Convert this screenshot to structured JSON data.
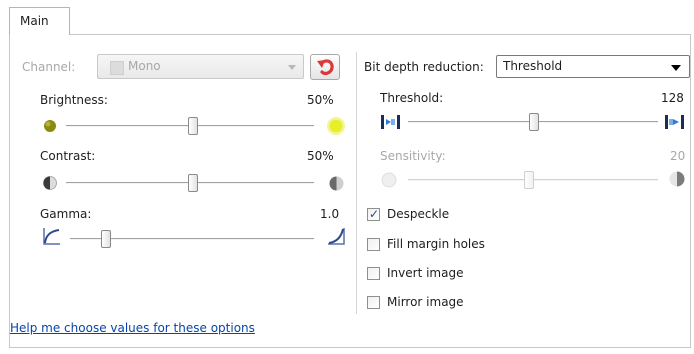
{
  "tabs": [
    {
      "label": "Main",
      "selected": true
    }
  ],
  "channel": {
    "label": "Channel:",
    "value": "Mono",
    "enabled": false
  },
  "reset_icon": "undo-arrow-icon",
  "sliders_left": [
    {
      "label": "Brightness:",
      "value": "50%",
      "position": 0.5,
      "left_icon": "brightness-low-icon",
      "right_icon": "brightness-high-icon"
    },
    {
      "label": "Contrast:",
      "value": "50%",
      "position": 0.5,
      "left_icon": "contrast-low-icon",
      "right_icon": "contrast-high-icon"
    },
    {
      "label": "Gamma:",
      "value": "1.0",
      "position": 0.12,
      "left_icon": "gamma-low-icon",
      "right_icon": "gamma-high-icon"
    }
  ],
  "bit_depth": {
    "label": "Bit depth reduction:",
    "value": "Threshold"
  },
  "sliders_right": [
    {
      "label": "Threshold:",
      "value": "128",
      "position": 0.5,
      "enabled": true,
      "left_icon": "threshold-low-icon",
      "right_icon": "threshold-high-icon"
    },
    {
      "label": "Sensitivity:",
      "value": "20",
      "position": 0.5,
      "enabled": false,
      "left_icon": "sensitivity-low-icon",
      "right_icon": "sensitivity-high-icon"
    }
  ],
  "checkboxes": [
    {
      "label": "Despeckle",
      "checked": true
    },
    {
      "label": "Fill margin holes",
      "checked": false
    },
    {
      "label": "Invert image",
      "checked": false
    },
    {
      "label": "Mirror image",
      "checked": false
    }
  ],
  "help_link": "Help me choose values for these options",
  "colors": {
    "link": "#0645ad",
    "disabled_text": "#a8a8a8",
    "reset_arrow": "#d83a3a",
    "checkmark": "#2c4a8c"
  }
}
